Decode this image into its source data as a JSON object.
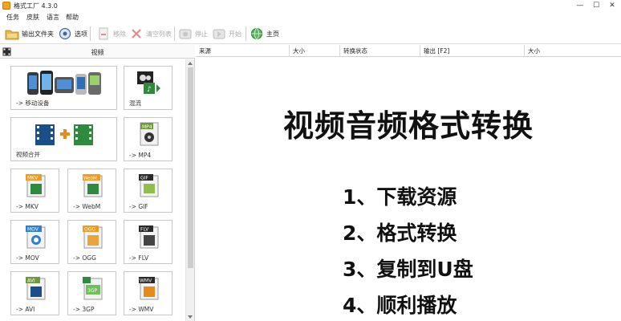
{
  "window": {
    "title": "格式工厂 4.3.0"
  },
  "window_controls": {
    "minimize": "—",
    "maximize": "☐",
    "close": "✕"
  },
  "menu": {
    "items": [
      "任务",
      "皮肤",
      "语言",
      "帮助"
    ]
  },
  "toolbar": {
    "output_folder": "输出文件夹",
    "options": "选项",
    "remove": "移除",
    "clear_list": "清空列表",
    "stop": "停止",
    "start": "开始",
    "home": "主页"
  },
  "left_panel": {
    "category": "视频",
    "tiles": [
      {
        "label": "-> 移动设备",
        "icon": "mobile-devices-icon"
      },
      {
        "label": "混流",
        "icon": "mux-icon"
      },
      {
        "label": "视频合并",
        "icon": "video-join-icon"
      },
      {
        "label": "-> MP4",
        "icon": "mp4-icon",
        "badge": "MP4"
      },
      {
        "label": "-> MKV",
        "icon": "mkv-icon",
        "badge": "MKV"
      },
      {
        "label": "-> WebM",
        "icon": "webm-icon",
        "badge": "WebM"
      },
      {
        "label": "-> GIF",
        "icon": "gif-icon",
        "badge": "GIF"
      },
      {
        "label": "-> MOV",
        "icon": "mov-icon",
        "badge": "MOV"
      },
      {
        "label": "-> OGG",
        "icon": "ogg-icon",
        "badge": "OGG"
      },
      {
        "label": "-> FLV",
        "icon": "flv-icon",
        "badge": "FLV"
      },
      {
        "label": "-> AVI",
        "icon": "avi-icon",
        "badge": "AVI"
      },
      {
        "label": "-> 3GP",
        "icon": "3gp-icon",
        "badge": "3GP"
      },
      {
        "label": "-> WMV",
        "icon": "wmv-icon",
        "badge": "WMV"
      }
    ]
  },
  "task_list": {
    "columns": [
      "来源",
      "大小",
      "转换状态",
      "输出 [F2]",
      "大小"
    ]
  },
  "overlay": {
    "title": "视频音频格式转换",
    "steps": [
      "1、下载资源",
      "2、格式转换",
      "3、复制到U盘",
      "4、顺利播放"
    ]
  },
  "colors": {
    "film_blue": "#1b4f8a",
    "film_green": "#2e8b3d",
    "badge_orange": "#f39a1e"
  }
}
